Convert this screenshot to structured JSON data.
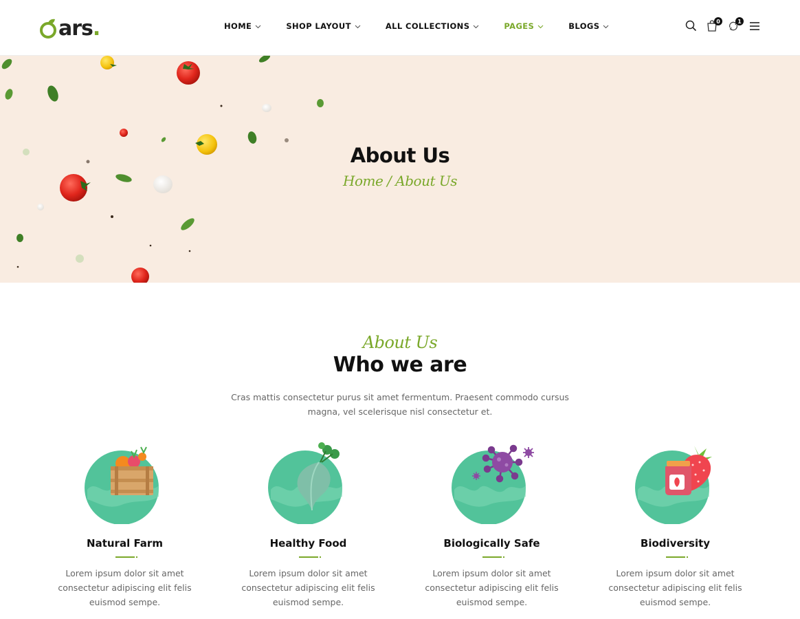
{
  "header": {
    "logo_text": "ars",
    "logo_dot": ".",
    "nav": [
      {
        "label": "HOME",
        "active": false
      },
      {
        "label": "SHOP LAYOUT",
        "active": false
      },
      {
        "label": "ALL COLLECTIONS",
        "active": false
      },
      {
        "label": "PAGES",
        "active": true
      },
      {
        "label": "BLOGS",
        "active": false
      }
    ],
    "cart_count": "0",
    "compare_count": "1",
    "icons": [
      "search-icon",
      "cart-icon",
      "compare-icon",
      "menu-icon"
    ]
  },
  "banner": {
    "title": "About Us",
    "breadcrumb_home": "Home",
    "breadcrumb_sep": " / ",
    "breadcrumb_current": "About Us"
  },
  "about": {
    "script_label": "About Us",
    "title": "Who we are",
    "description": "Cras mattis consectetur purus sit amet fermentum. Praesent commodo cursus magna, vel scelerisque nisl consectetur et.",
    "features": [
      {
        "title": "Natural Farm",
        "text": "Lorem ipsum dolor sit amet consectetur adipiscing elit felis euismod sempe.",
        "icon": "farm-crate-icon"
      },
      {
        "title": "Healthy Food",
        "text": "Lorem ipsum dolor sit amet consectetur adipiscing elit felis euismod sempe.",
        "icon": "beet-icon"
      },
      {
        "title": "Biologically Safe",
        "text": "Lorem ipsum dolor sit amet consectetur adipiscing elit felis euismod sempe.",
        "icon": "virus-icon"
      },
      {
        "title": "Biodiversity",
        "text": "Lorem ipsum dolor sit amet consectetur adipiscing elit felis euismod sempe.",
        "icon": "jam-strawberry-icon"
      }
    ]
  },
  "colors": {
    "accent": "#7aa82a",
    "banner_bg": "#f9ece1",
    "icon_circle": "#52c39a"
  }
}
